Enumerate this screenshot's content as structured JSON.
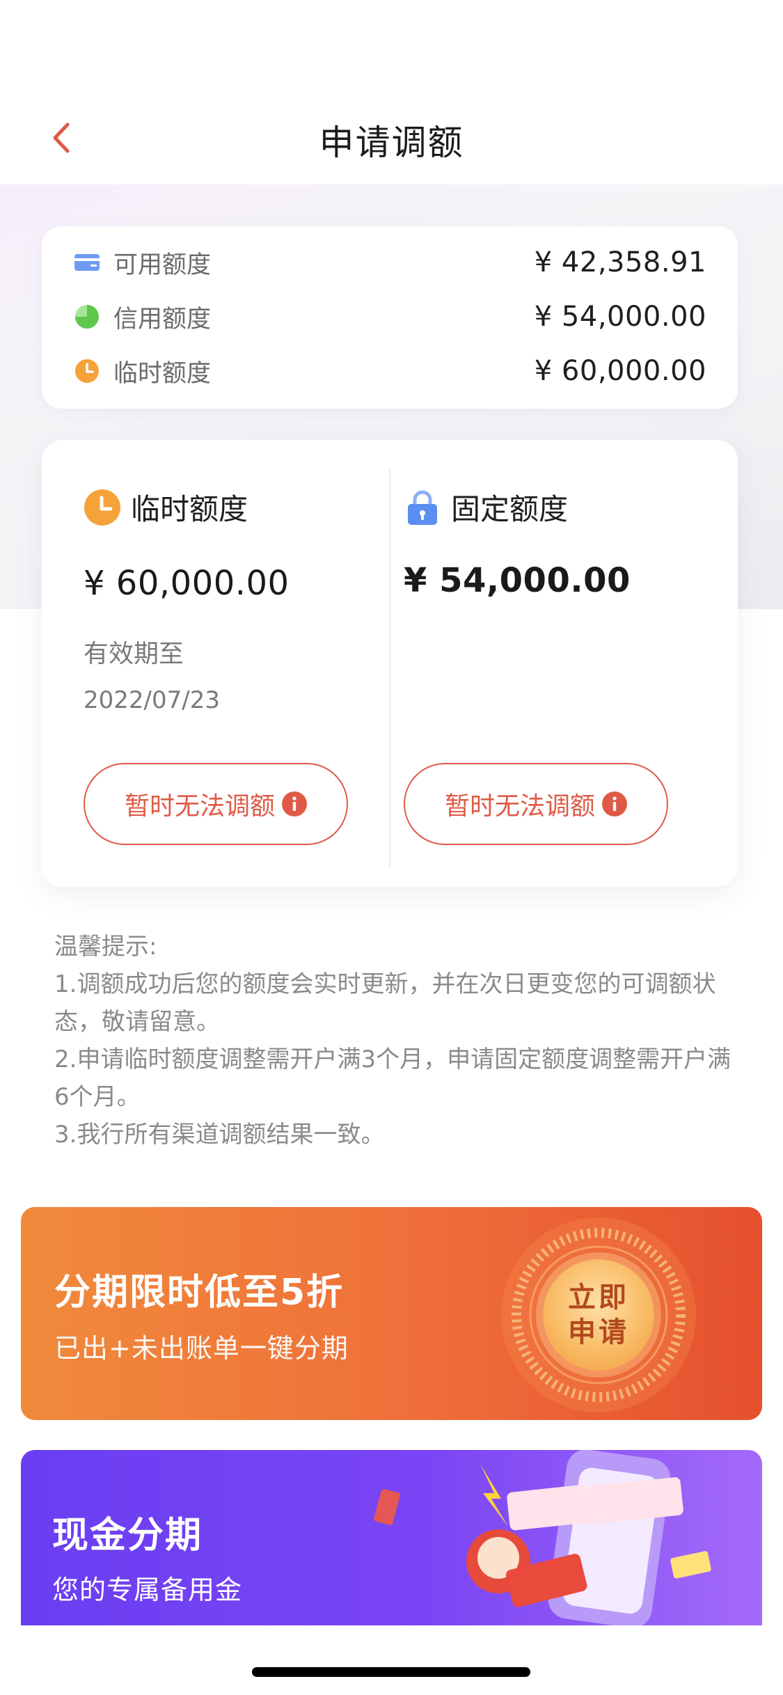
{
  "header": {
    "title": "申请调额"
  },
  "summary": {
    "items": [
      {
        "label": "可用额度",
        "value": "¥ 42,358.91",
        "icon": "card-icon",
        "color": "#6d9bf0"
      },
      {
        "label": "信用额度",
        "value": "¥ 54,000.00",
        "icon": "pie-icon",
        "color": "#7fd36e"
      },
      {
        "label": "临时额度",
        "value": "¥ 60,000.00",
        "icon": "clock-icon",
        "color": "#f5a23a"
      }
    ]
  },
  "temp_quota": {
    "title": "临时额度",
    "amount": "¥ 60,000.00",
    "valid_label": "有效期至",
    "valid_date": "2022/07/23",
    "button": "暂时无法调额"
  },
  "fixed_quota": {
    "title": "固定额度",
    "amount": "¥ 54,000.00",
    "button": "暂时无法调额"
  },
  "tips": {
    "title": "温馨提示:",
    "lines": [
      "1.调额成功后您的额度会实时更新，并在次日更变您的可调额状态，敬请留意。",
      "2.申请临时额度调整需开户满3个月，申请固定额度调整需开户满6个月。",
      "3.我行所有渠道调额结果一致。"
    ]
  },
  "promo_installment": {
    "title": "分期限时低至5折",
    "subtitle": "已出+未出账单一键分期",
    "badge_line1": "立即",
    "badge_line2": "申请"
  },
  "promo_cash": {
    "title": "现金分期",
    "subtitle": "您的专属备用金"
  },
  "colors": {
    "accent": "#df5a46",
    "orange": "#f5a23a",
    "blue": "#6d9bf0"
  }
}
